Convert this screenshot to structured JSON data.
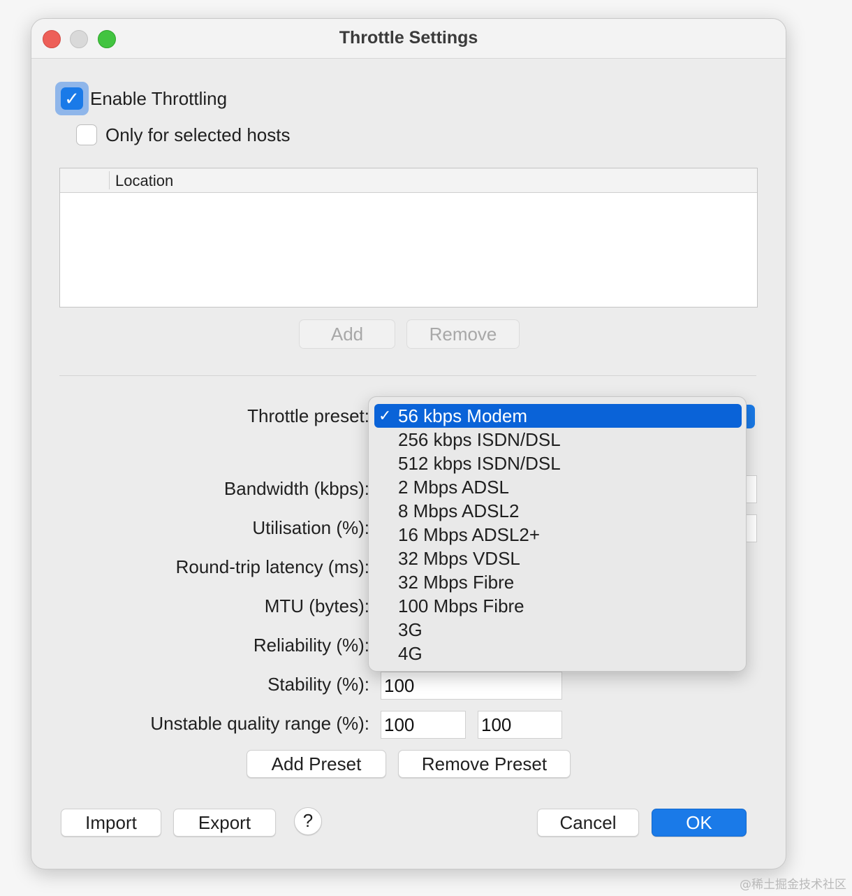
{
  "window": {
    "title": "Throttle Settings"
  },
  "enable_throttling": {
    "label": "Enable Throttling",
    "checked": true
  },
  "selected_hosts": {
    "label": "Only for selected hosts",
    "checked": false
  },
  "hosts_table": {
    "column": "Location"
  },
  "host_buttons": {
    "add": "Add",
    "remove": "Remove"
  },
  "preset": {
    "label": "Throttle preset:",
    "selected": "56 kbps Modem",
    "options": [
      "56 kbps Modem",
      "256 kbps ISDN/DSL",
      "512 kbps ISDN/DSL",
      "2 Mbps ADSL",
      "8 Mbps ADSL2",
      "16 Mbps ADSL2+",
      "32 Mbps VDSL",
      "32 Mbps Fibre",
      "100 Mbps Fibre",
      "3G",
      "4G"
    ]
  },
  "fields": {
    "bandwidth": "Bandwidth (kbps):",
    "utilisation": "Utilisation (%):",
    "latency": "Round-trip latency (ms):",
    "mtu": "MTU (bytes):",
    "reliability": "Reliability (%):",
    "stability": {
      "label": "Stability (%):",
      "value": "100"
    },
    "unstable": {
      "label": "Unstable quality range (%):",
      "min": "100",
      "max": "100"
    }
  },
  "preset_buttons": {
    "add": "Add Preset",
    "remove": "Remove Preset"
  },
  "footer": {
    "import": "Import",
    "export": "Export",
    "help": "?",
    "cancel": "Cancel",
    "ok": "OK"
  },
  "watermark": "@稀土掘金技术社区",
  "colors": {
    "accent": "#1a7ae8",
    "selection": "#0a63d8",
    "close": "#ed5f58",
    "maximize": "#42c440"
  }
}
